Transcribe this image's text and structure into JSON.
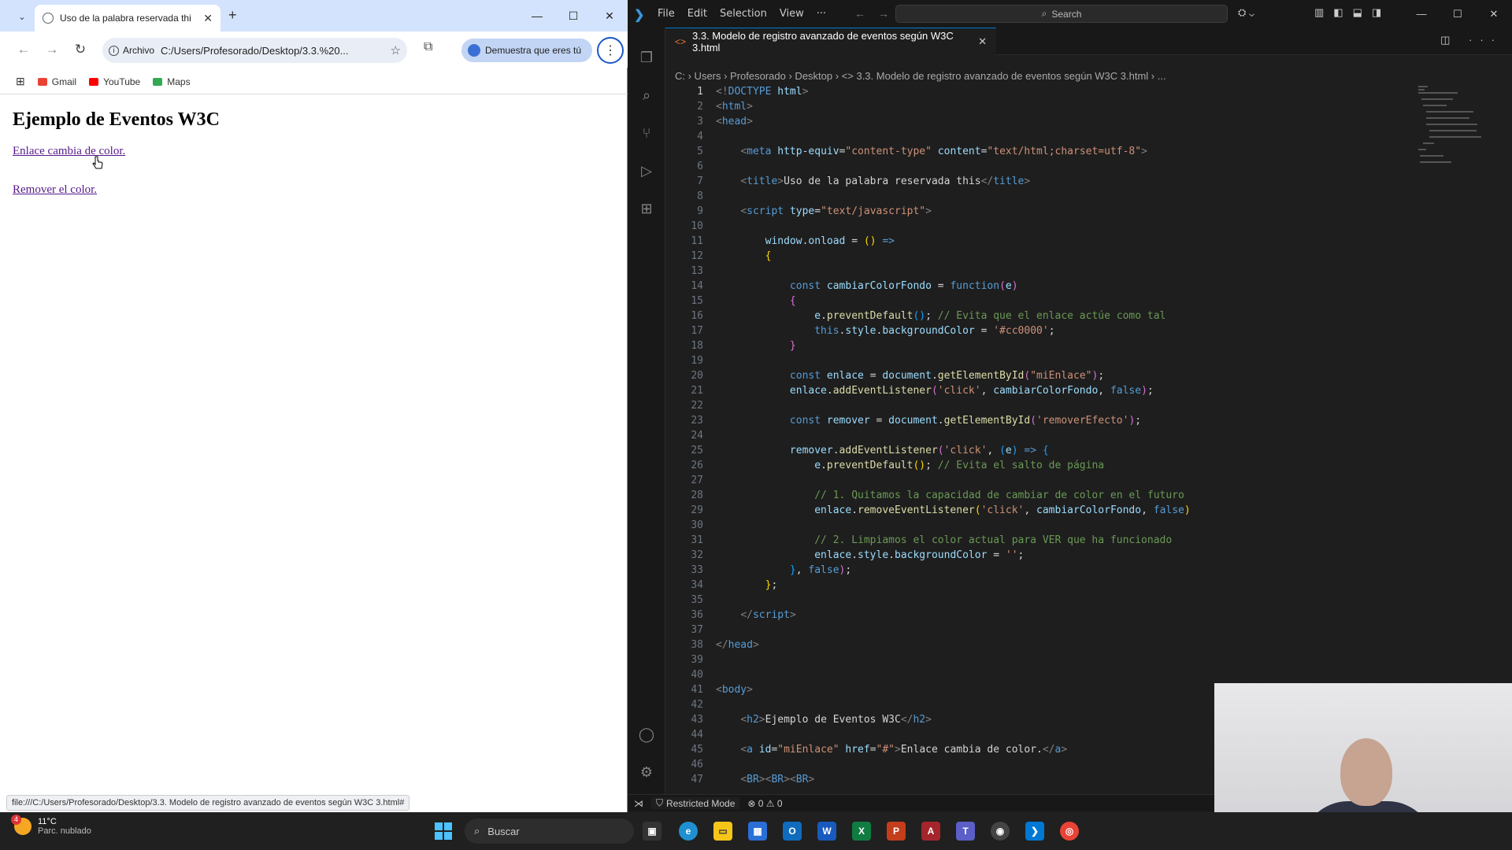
{
  "browser": {
    "tab_title": "Uso de la palabra reservada thi",
    "address_chip": "Archivo",
    "url": "C:/Users/Profesorado/Desktop/3.3.%20...",
    "profile_label": "Demuestra que eres tú",
    "bookmarks": [
      "Gmail",
      "YouTube",
      "Maps"
    ],
    "page": {
      "heading": "Ejemplo de Eventos W3C",
      "link1": "Enlace cambia de color.",
      "link2": "Remover el color."
    },
    "status_url": "file:///C:/Users/Profesorado/Desktop/3.3. Modelo de registro avanzado de eventos según W3C 3.html#"
  },
  "vscode": {
    "menu": [
      "File",
      "Edit",
      "Selection",
      "View",
      "···"
    ],
    "search_placeholder": "Search",
    "tab_label": "3.3. Modelo de registro avanzado de eventos según W3C 3.html",
    "breadcrumb": "C: › Users › Profesorado › Desktop › <> 3.3. Modelo de registro avanzado de eventos según W3C 3.html › ...",
    "status": {
      "restricted": "Restricted Mode",
      "problems": "0",
      "warnings": "0"
    }
  },
  "taskbar": {
    "temperature": "11°C",
    "weather": "Parc. nublado",
    "weather_badge": "4",
    "search_label": "Buscar"
  },
  "colors": {
    "vscode_bg": "#1e1e1e",
    "accent": "#0078d4",
    "link_visited": "#551a8b"
  }
}
